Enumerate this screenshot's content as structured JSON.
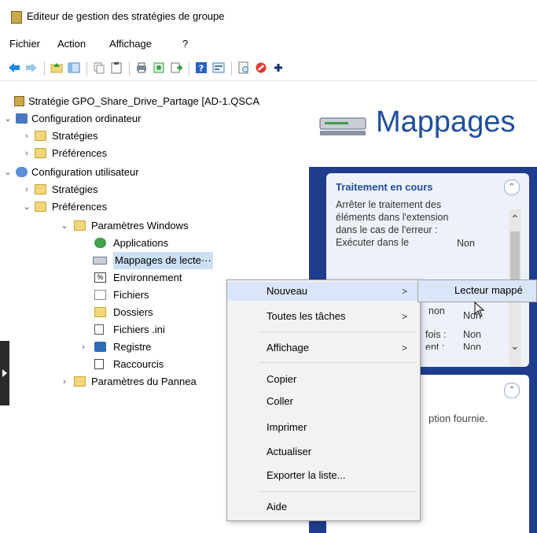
{
  "window": {
    "title": "Editeur de gestion des stratégies de groupe"
  },
  "menubar": {
    "items": [
      "Fichier",
      "Action",
      "Affichage",
      "?"
    ]
  },
  "toolbar": {
    "icons": [
      "back-arrow-icon",
      "forward-arrow-icon",
      "up-folder-icon",
      "show-hide-tree-icon",
      "copy-icon",
      "paste-icon",
      "print-icon",
      "properties-icon",
      "export-icon",
      "help-icon",
      "console-icon",
      "new-item-icon",
      "stop-icon",
      "add-icon"
    ],
    "colors": {
      "arrows": "#1e88e5",
      "stop": "#e53935",
      "help": "#2961c8"
    }
  },
  "tree": {
    "root": "Stratégie GPO_Share_Drive_Partage [AD-1.QSCA",
    "computer_config": "Configuration ordinateur",
    "cc_strategies": "Stratégies",
    "cc_preferences": "Préférences",
    "user_config": "Configuration utilisateur",
    "uc_strategies": "Stratégies",
    "uc_preferences": "Préférences",
    "windows_settings": "Paramètres Windows",
    "applications": "Applications",
    "drive_maps": "Mappages de lecte···",
    "environment": "Environnement",
    "files": "Fichiers",
    "folders": "Dossiers",
    "ini_files": "Fichiers .ini",
    "registry": "Registre",
    "shortcuts": "Raccourcis",
    "control_panel": "Paramètres du Pannea"
  },
  "right_pane": {
    "title": "Mappages",
    "card1": {
      "title": "Traitement en cours",
      "line1": "Arrêter le traitement des éléments dans l'extension dans le cas de l'erreur :",
      "value1": "Non",
      "line2": "Exécuter dans le",
      "value2": "non",
      "value3": "Non",
      "line3": "fois :",
      "value4": "Non",
      "line4": "ent :",
      "value5": "Non"
    },
    "card2": {
      "text": "ption fournie."
    },
    "accent_color": "#1e3d8c"
  },
  "context_menu": {
    "items": [
      {
        "label": "Nouveau",
        "submenu": true
      },
      {
        "label": "Toutes les tâches",
        "submenu": true
      },
      {
        "label": "Affichage",
        "submenu": true
      },
      {
        "label": "Copier"
      },
      {
        "label": "Coller"
      },
      {
        "label": "Imprimer"
      },
      {
        "label": "Actualiser"
      },
      {
        "label": "Exporter la liste..."
      },
      {
        "label": "Aide"
      }
    ],
    "submenu_arrow": ">"
  },
  "submenu": {
    "label": "Lecteur mappé"
  }
}
